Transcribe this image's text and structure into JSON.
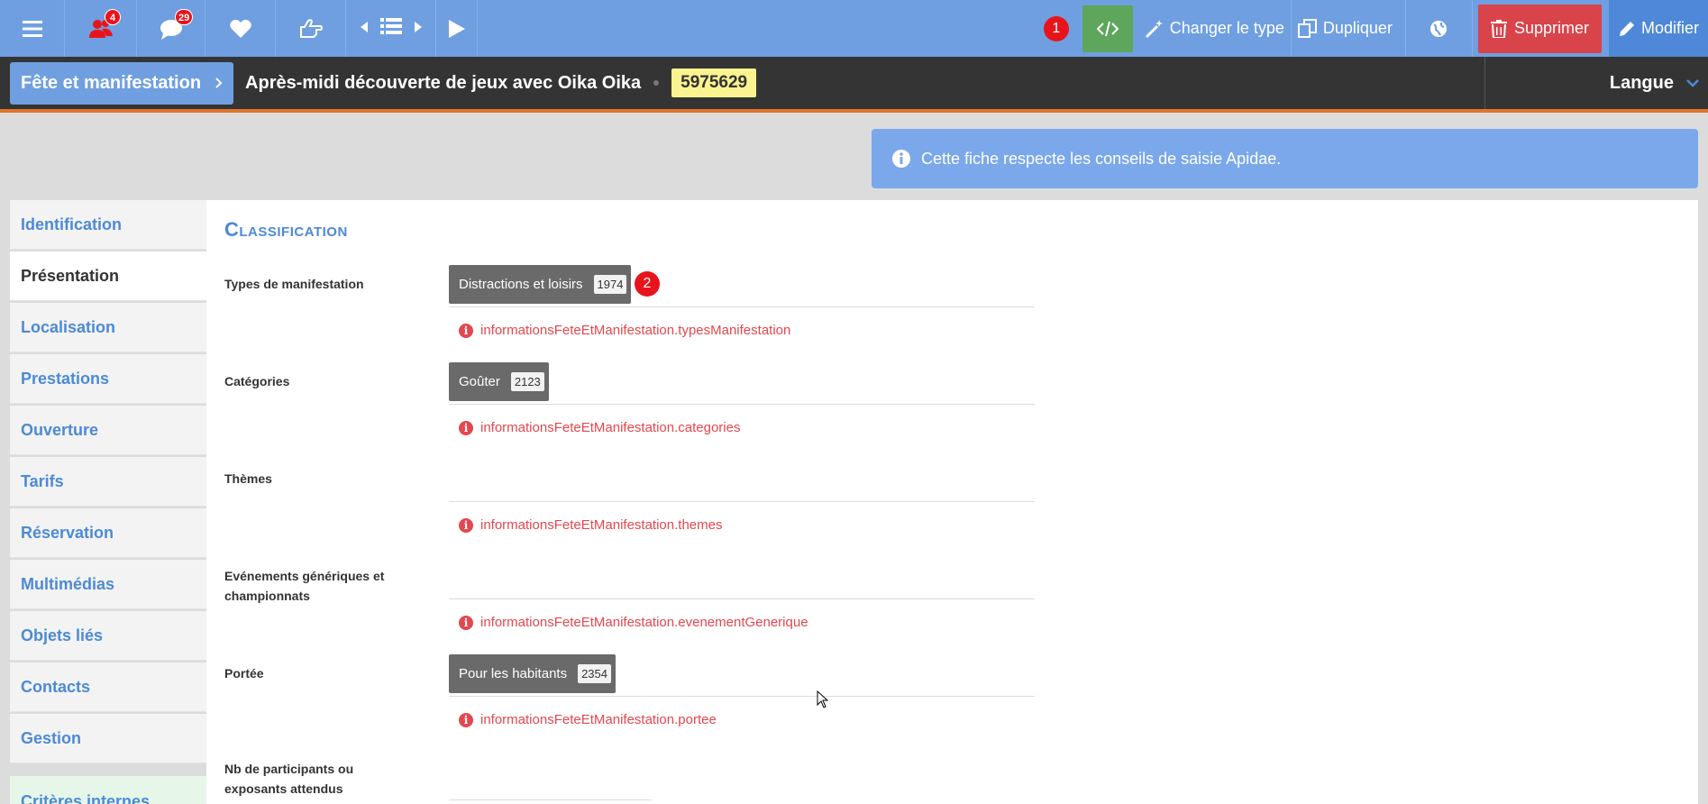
{
  "toolbar": {
    "notifications_users_count": "4",
    "notifications_comments_count": "29",
    "marker_1": "1",
    "change_type_label": "Changer le type",
    "duplicate_label": "Dupliquer",
    "delete_label": "Supprimer",
    "modify_label": "Modifier"
  },
  "header": {
    "breadcrumb": "Fête et manifestation",
    "title": "Après-midi découverte de jeux avec Oika Oika",
    "record_id": "5975629",
    "language_label": "Langue"
  },
  "info_banner": {
    "message": "Cette fiche respecte les conseils de saisie Apidae."
  },
  "sidebar": {
    "items": [
      {
        "label": "Identification"
      },
      {
        "label": "Présentation"
      },
      {
        "label": "Localisation"
      },
      {
        "label": "Prestations"
      },
      {
        "label": "Ouverture"
      },
      {
        "label": "Tarifs"
      },
      {
        "label": "Réservation"
      },
      {
        "label": "Multimédias"
      },
      {
        "label": "Objets liés"
      },
      {
        "label": "Contacts"
      },
      {
        "label": "Gestion"
      }
    ],
    "extra_label": "Critères internes"
  },
  "main": {
    "section_title": "Classification",
    "marker_2": "2",
    "fields": [
      {
        "label": "Types de manifestation",
        "tag_label": "Distractions et loisirs",
        "tag_count": "1974",
        "error": "informationsFeteEtManifestation.typesManifestation"
      },
      {
        "label": "Catégories",
        "tag_label": "Goûter",
        "tag_count": "2123",
        "error": "informationsFeteEtManifestation.categories"
      },
      {
        "label": "Thèmes",
        "error": "informationsFeteEtManifestation.themes"
      },
      {
        "label": "Evénements génériques et championnats",
        "error": "informationsFeteEtManifestation.evenementGenerique"
      },
      {
        "label": "Portée",
        "tag_label": "Pour les habitants",
        "tag_count": "2354",
        "error": "informationsFeteEtManifestation.portee"
      },
      {
        "label": "Nb de participants ou exposants attendus"
      }
    ]
  }
}
